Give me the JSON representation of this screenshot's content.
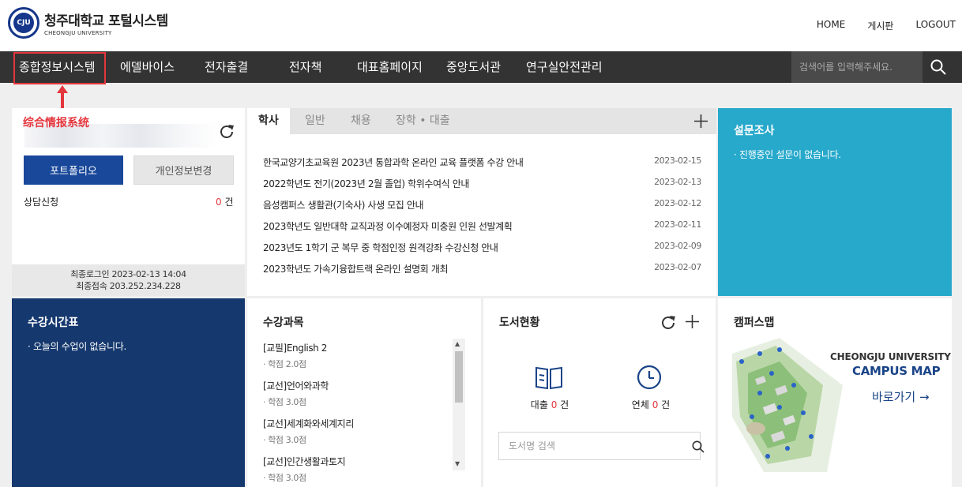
{
  "header": {
    "logo_ko": "청주대학교 포털시스템",
    "logo_en": "CHEONGJU UNIVERSITY",
    "seal_text": "CJU",
    "utils": [
      "HOME",
      "게시판",
      "LOGOUT"
    ]
  },
  "nav": {
    "items": [
      "종합정보시스템",
      "에델바이스",
      "전자출결",
      "전자책",
      "대표홈페이지",
      "중앙도서관",
      "연구실안전관리"
    ],
    "search_placeholder": "검색어를 입력해주세요."
  },
  "annotation": {
    "label": "综合情报系统",
    "color": "#e4363d"
  },
  "user": {
    "portfolio_label": "포트폴리오",
    "edit_info_label": "개인정보변경",
    "counsel_label": "상담신청",
    "counsel_count": "0",
    "counsel_unit": "건",
    "last_login": "최종로그인 2023-02-13 14:04",
    "last_ip": "최종접속 203.252.234.228"
  },
  "notices": {
    "tabs": [
      "학사",
      "일반",
      "채용",
      "장학 • 대출"
    ],
    "items": [
      {
        "title": "한국교양기초교육원 2023년 통합과학 온라인 교육 플랫폼 수강 안내",
        "date": "2023-02-15"
      },
      {
        "title": "2022학년도 전기(2023년 2월 졸업) 학위수여식 안내",
        "date": "2023-02-13"
      },
      {
        "title": "음성캠퍼스 생활관(기숙사) 사생 모집 안내",
        "date": "2023-02-12"
      },
      {
        "title": "2023학년도 일반대학 교직과정 이수예정자 미충원 인원 선발계획",
        "date": "2023-02-11"
      },
      {
        "title": "2023년도 1학기 군 복무 중 학점인정 원격강좌 수강신청 안내",
        "date": "2023-02-09"
      },
      {
        "title": "2023학년도 가속기융합트랙 온라인 설명회 개최",
        "date": "2023-02-07"
      }
    ]
  },
  "survey": {
    "title": "설문조사",
    "text": "· 진행중인 설문이 없습니다."
  },
  "timetable": {
    "title": "수강시간표",
    "text": "· 오늘의 수업이 없습니다."
  },
  "courses": {
    "title": "수강과목",
    "items": [
      {
        "name": "[교필]English 2",
        "credit": "· 학점 2.0점"
      },
      {
        "name": "[교선]언어와과학",
        "credit": "· 학점 3.0점"
      },
      {
        "name": "[교선]세계화와세계지리",
        "credit": "· 학점 3.0점"
      },
      {
        "name": "[교선]인간생활과토지",
        "credit": "· 학점 3.0점"
      }
    ]
  },
  "library": {
    "title": "도서현황",
    "loan_label": "대출",
    "loan_count": "0",
    "overdue_label": "연체",
    "overdue_count": "0",
    "unit": "건",
    "search_placeholder": "도서명 검색"
  },
  "campus_map": {
    "title": "캠퍼스맵",
    "line1": "CHEONGJU UNIVERSITY",
    "line2": "CAMPUS MAP",
    "go_label": "바로가기 →"
  },
  "colors": {
    "nav_bg": "#333333",
    "primary_blue": "#19489a",
    "survey_bg": "#27a9cb",
    "timetable_bg": "#15386e",
    "alert_red": "#e4363d"
  }
}
